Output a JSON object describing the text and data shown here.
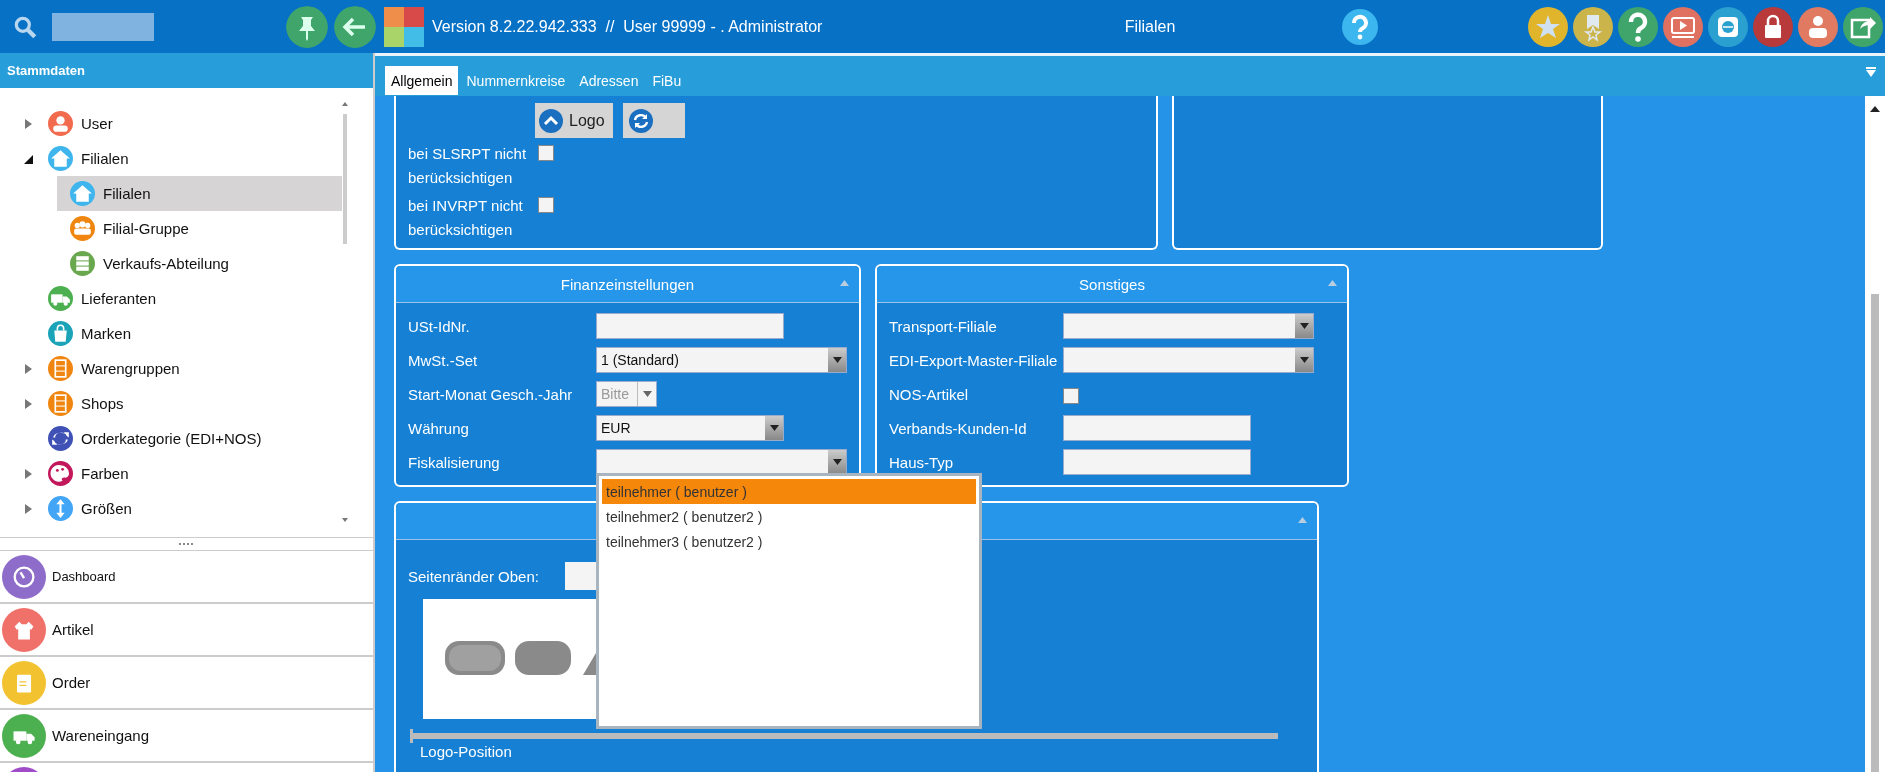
{
  "topbar": {
    "version": "Version 8.2.22.942.333  //  User 99999 - . Administrator",
    "title": "Filialen"
  },
  "sidebar": {
    "title": "Stammdaten",
    "tree": [
      {
        "label": "User",
        "color": "#f26b4f",
        "expanded": false,
        "selected": false
      },
      {
        "label": "Filialen",
        "color": "#3fb5ee",
        "expanded": true,
        "selected": false,
        "children": [
          {
            "label": "Filialen",
            "color": "#3fb5ee",
            "selected": true
          },
          {
            "label": "Filial-Gruppe",
            "color": "#f0860f",
            "selected": false
          },
          {
            "label": "Verkaufs-Abteilung",
            "color": "#6aa84f",
            "selected": false
          }
        ]
      },
      {
        "label": "Lieferanten",
        "color": "#4caf50",
        "selected": false
      },
      {
        "label": "Marken",
        "color": "#1ba3b8",
        "selected": false
      },
      {
        "label": "Warengruppen",
        "color": "#f0860f",
        "expanded": false,
        "selected": false
      },
      {
        "label": "Shops",
        "color": "#f0860f",
        "expanded": false,
        "selected": false
      },
      {
        "label": "Orderkategorie (EDI+NOS)",
        "color": "#3f51b5",
        "selected": false
      },
      {
        "label": "Farben",
        "color": "#c2185b",
        "expanded": false,
        "selected": false
      },
      {
        "label": "Größen",
        "color": "#42a5f5",
        "expanded": false,
        "selected": false
      }
    ],
    "nav": [
      {
        "label": "Dashboard",
        "color": "#8e6cc9"
      },
      {
        "label": "Artikel",
        "color": "#f0706a"
      },
      {
        "label": "Order",
        "color": "#f2c230"
      },
      {
        "label": "Wareneingang",
        "color": "#4caf50"
      },
      {
        "color": "#a04cc8"
      }
    ]
  },
  "tabs": [
    {
      "label": "Allgemein",
      "selected": true
    },
    {
      "label": "Nummernkreise",
      "selected": false
    },
    {
      "label": "Adressen",
      "selected": false
    },
    {
      "label": "FiBu",
      "selected": false
    }
  ],
  "general": {
    "logo_button": "Logo",
    "checkboxes": [
      {
        "label": "bei SLSRPT nicht berücksichtigen",
        "checked": false
      },
      {
        "label": "bei INVRPT nicht berücksichtigen",
        "checked": false
      }
    ]
  },
  "finance": {
    "title": "Finanzeinstellungen",
    "fields": [
      {
        "label": "USt-IdNr.",
        "kind": "text"
      },
      {
        "label": "MwSt.-Set",
        "kind": "select",
        "value": "1 (Standard)"
      },
      {
        "label": "Start-Monat Gesch.-Jahr",
        "kind": "select",
        "placeholder": "Bitte"
      },
      {
        "label": "Währung",
        "kind": "select",
        "value": "EUR"
      },
      {
        "label": "Fiskalisierung",
        "kind": "select",
        "options": [
          {
            "label": "teilnehmer ( benutzer )",
            "selected": true
          },
          {
            "label": "teilnehmer2 ( benutzer2 )",
            "selected": false
          },
          {
            "label": "teilnehmer3 ( benutzer2 )",
            "selected": false
          }
        ]
      }
    ]
  },
  "other": {
    "title": "Sonstiges",
    "fields": [
      {
        "label": "Transport-Filiale",
        "kind": "select"
      },
      {
        "label": "EDI-Export-Master-Filiale",
        "kind": "select"
      },
      {
        "label": "NOS-Artikel",
        "kind": "checkbox",
        "checked": false
      },
      {
        "label": "Verbands-Kunden-Id",
        "kind": "text"
      },
      {
        "label": "Haus-Typ",
        "kind": "text"
      }
    ]
  },
  "layout_panel": {
    "margin_label": "Seitenränder Oben:",
    "slider": {
      "level": 0
    },
    "position_label": "Logo-Position"
  }
}
